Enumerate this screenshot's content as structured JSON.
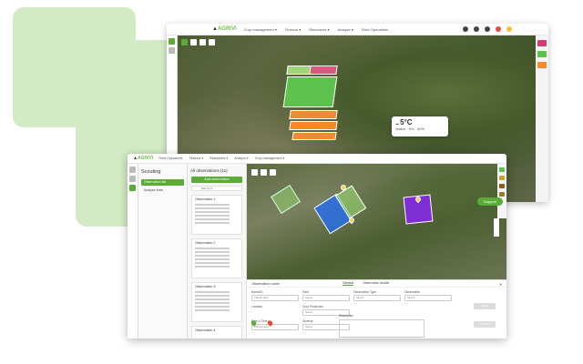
{
  "brand": {
    "name_prefix": "AGRIVI",
    "accent": "#5bab37"
  },
  "back_window": {
    "menu": [
      "Crop management ▾",
      "Finance ▾",
      "Resources ▾",
      "Analyze ▾",
      "Field Operations"
    ],
    "weather": {
      "temp": "5°C",
      "line": "Watch · 0% · 50%",
      "icon": "cloud-icon"
    }
  },
  "front_window": {
    "menu": [
      "Field Operations",
      "Finance ▾",
      "Resources ▾",
      "Analyze ▾",
      "Crop management ▾"
    ],
    "scouting": {
      "title": "Scouting",
      "items": [
        "Observation list",
        "Analyze Area"
      ]
    },
    "observations": {
      "title": "All observations (11)",
      "add_label": "Add observation",
      "filter_label": "Sort by ▾",
      "cards": [
        "Observation 1",
        "Observation 2",
        "Observation 3",
        "Observation 4"
      ]
    },
    "support_label": "Support",
    "form": {
      "header": "Observation name",
      "tabs": [
        "General",
        "Observation details"
      ],
      "fields": [
        {
          "label": "Name/ID",
          "placeholder": "Placeholder"
        },
        {
          "label": "Field",
          "placeholder": "Select"
        },
        {
          "label": "Observation Type",
          "placeholder": "Select"
        },
        {
          "label": "Observation",
          "placeholder": "Select"
        },
        {
          "label": "Location",
          "placeholder": ""
        },
        {
          "label": "Crop Production",
          "placeholder": "Select"
        },
        {
          "label": "Description",
          "placeholder": ""
        },
        {
          "label": "",
          "placeholder": ""
        },
        {
          "label": "Date & Time",
          "placeholder": "Placeholder"
        },
        {
          "label": "Severity",
          "placeholder": "Select"
        }
      ],
      "save_label": "Save",
      "cancel_label": "Cancel"
    }
  }
}
